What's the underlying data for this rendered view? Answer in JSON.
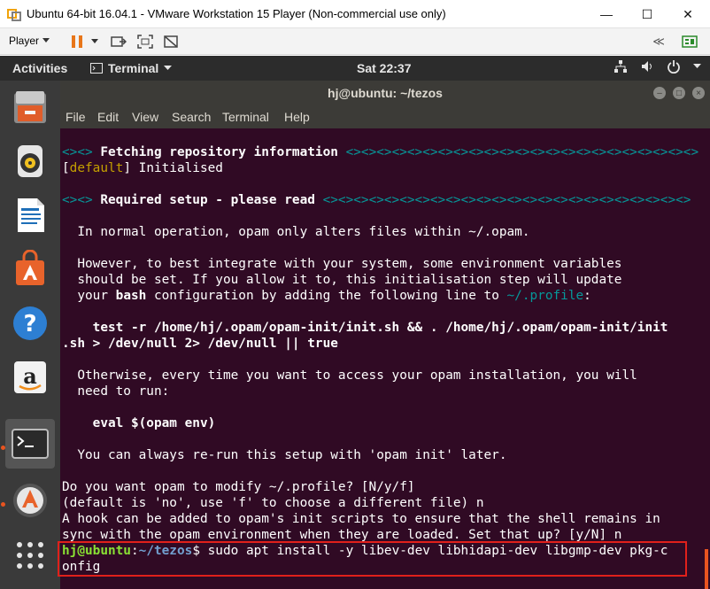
{
  "vm": {
    "window_title": "Ubuntu 64-bit 16.04.1 - VMware Workstation 15 Player (Non-commercial use only)",
    "player_menu": "Player",
    "minimize": "—",
    "maximize": "☐",
    "close": "✕",
    "back_arrows": "≪"
  },
  "gnome": {
    "activities": "Activities",
    "app_menu": "Terminal",
    "clock": "Sat 22:37"
  },
  "dock": {
    "items": [
      "Files",
      "Rhythmbox",
      "LibreOffice Writer",
      "Ubuntu Software",
      "Help",
      "Amazon",
      "Terminal",
      "Software Updater",
      "Show Applications"
    ]
  },
  "terminal": {
    "title": "hj@ubuntu: ~/tezos",
    "menu": [
      "File",
      "Edit",
      "View",
      "Search",
      "Terminal",
      "Help"
    ],
    "lines": [
      {
        "segs": [
          {
            "t": "<><> ",
            "c": "cyan"
          },
          {
            "t": "Fetching repository information",
            "c": "b"
          },
          {
            "t": " <><><><><><><><><><><><><><><><><><><><><><><>",
            "c": "cyan"
          }
        ]
      },
      {
        "segs": [
          {
            "t": "[",
            "c": ""
          },
          {
            "t": "default",
            "c": "yellowish"
          },
          {
            "t": "] Initialised",
            "c": ""
          }
        ]
      },
      {
        "segs": [
          {
            "t": "",
            "c": ""
          }
        ]
      },
      {
        "segs": [
          {
            "t": "<><> ",
            "c": "cyan"
          },
          {
            "t": "Required setup - please read",
            "c": "b"
          },
          {
            "t": " <><><><><><><><><><><><><><><><><><><><><><><><>",
            "c": "cyan"
          }
        ]
      },
      {
        "segs": [
          {
            "t": "",
            "c": ""
          }
        ]
      },
      {
        "segs": [
          {
            "t": "  In normal operation, opam only alters files within ~/.opam.",
            "c": ""
          }
        ]
      },
      {
        "segs": [
          {
            "t": "",
            "c": ""
          }
        ]
      },
      {
        "segs": [
          {
            "t": "  However, to best integrate with your system, some environment variables",
            "c": ""
          }
        ]
      },
      {
        "segs": [
          {
            "t": "  should be set. If you allow it to, this initialisation step will update",
            "c": ""
          }
        ]
      },
      {
        "segs": [
          {
            "t": "  your ",
            "c": ""
          },
          {
            "t": "bash",
            "c": "b"
          },
          {
            "t": " configuration by adding the following line to ",
            "c": ""
          },
          {
            "t": "~/.profile",
            "c": "cyan"
          },
          {
            "t": ":",
            "c": ""
          }
        ]
      },
      {
        "segs": [
          {
            "t": "",
            "c": ""
          }
        ]
      },
      {
        "segs": [
          {
            "t": "    test -r /home/hj/.opam/opam-init/init.sh && . /home/hj/.opam/opam-init/init",
            "c": "b"
          }
        ]
      },
      {
        "segs": [
          {
            "t": ".sh > /dev/null 2> /dev/null || true",
            "c": "b"
          }
        ]
      },
      {
        "segs": [
          {
            "t": "",
            "c": ""
          }
        ]
      },
      {
        "segs": [
          {
            "t": "  Otherwise, every time you want to access your opam installation, you will",
            "c": ""
          }
        ]
      },
      {
        "segs": [
          {
            "t": "  need to run:",
            "c": ""
          }
        ]
      },
      {
        "segs": [
          {
            "t": "",
            "c": ""
          }
        ]
      },
      {
        "segs": [
          {
            "t": "    eval $(opam env)",
            "c": "b"
          }
        ]
      },
      {
        "segs": [
          {
            "t": "",
            "c": ""
          }
        ]
      },
      {
        "segs": [
          {
            "t": "  You can always re-run this setup with 'opam init' later.",
            "c": ""
          }
        ]
      },
      {
        "segs": [
          {
            "t": "",
            "c": ""
          }
        ]
      },
      {
        "segs": [
          {
            "t": "Do you want opam to modify ~/.profile? [N/y/f]",
            "c": ""
          }
        ]
      },
      {
        "segs": [
          {
            "t": "(default is 'no', use 'f' to choose a different file) n",
            "c": ""
          }
        ]
      },
      {
        "segs": [
          {
            "t": "A hook can be added to opam's init scripts to ensure that the shell remains in",
            "c": ""
          }
        ]
      },
      {
        "segs": [
          {
            "t": "sync with the opam environment when they are loaded. Set that up? [y/N] n",
            "c": ""
          }
        ]
      },
      {
        "segs": [
          {
            "t": "hj@ubuntu",
            "c": "green"
          },
          {
            "t": ":",
            "c": ""
          },
          {
            "t": "~/tezos",
            "c": "blue b"
          },
          {
            "t": "$ sudo apt install -y libev-dev libhidapi-dev libgmp-dev pkg-c",
            "c": ""
          }
        ]
      },
      {
        "segs": [
          {
            "t": "onfig",
            "c": ""
          }
        ]
      }
    ]
  },
  "colors": {
    "terminal_bg": "#300a24",
    "prompt_user": "#8ae234",
    "prompt_path": "#729fcf",
    "accent": "#e95420",
    "highlight_box": "#e0201b"
  }
}
